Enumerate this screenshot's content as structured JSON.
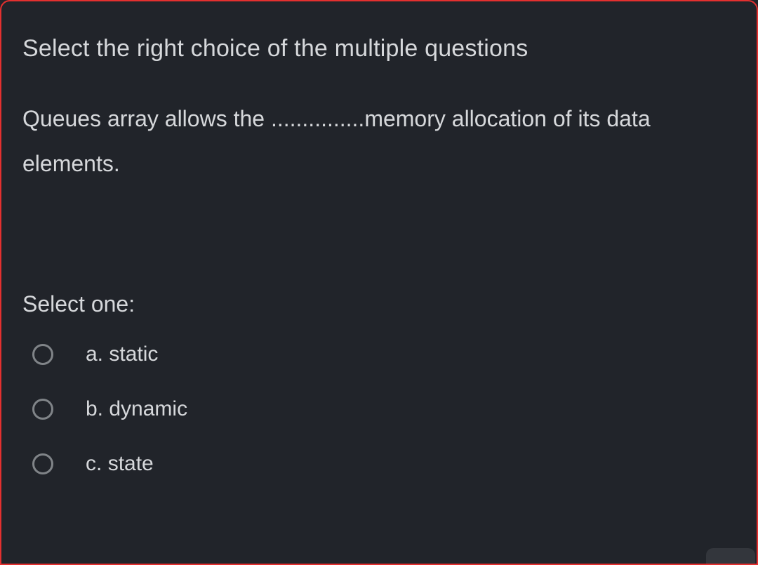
{
  "question_card": {
    "title": "Select the right choice of the multiple questions",
    "prompt": "Queues array allows the ...............memory allocation of its data elements.",
    "select_label": "Select one:",
    "options": [
      {
        "letter": "a.",
        "text": "static"
      },
      {
        "letter": "b.",
        "text": "dynamic"
      },
      {
        "letter": "c.",
        "text": "state"
      }
    ]
  }
}
